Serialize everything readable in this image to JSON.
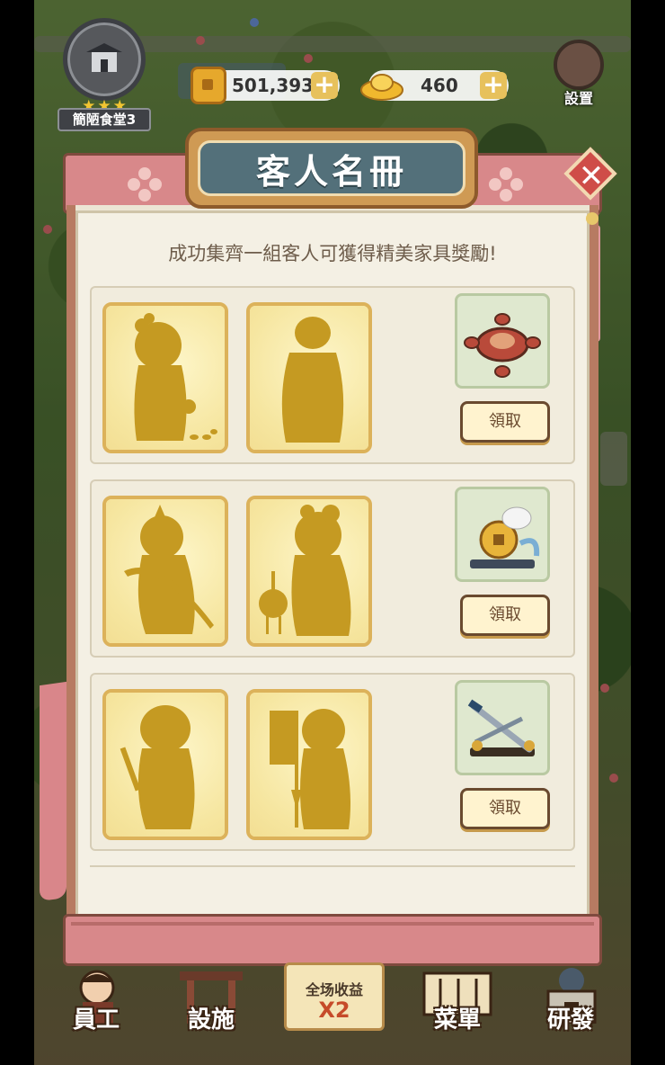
{
  "hud": {
    "restaurant_name": "簡陋食堂3",
    "stars": "★★★",
    "coins": "501,393",
    "gold": "460",
    "settings_label": "設置",
    "plus": "+"
  },
  "dialog": {
    "title": "客人名冊",
    "close": "✕",
    "subtitle": "成功集齊一組客人可獲得精美家具獎勵!",
    "claim_label": "領取",
    "groups": [
      {
        "reward_icon": "round-table-set-icon",
        "guests": [
          "guest-silhouette-lady",
          "guest-silhouette-scholar"
        ]
      },
      {
        "reward_icon": "lucky-coin-rabbit-decor-icon",
        "guests": [
          "guest-silhouette-archer",
          "guest-silhouette-lantern-girl"
        ]
      },
      {
        "reward_icon": "sword-rack-icon",
        "guests": [
          "guest-silhouette-swordsman",
          "guest-silhouette-banner-bearer"
        ]
      }
    ]
  },
  "nav": {
    "staff": "員工",
    "facilities": "設施",
    "boost_line1": "全场收益",
    "boost_line2": "X2",
    "menu": "菜單",
    "research": "研發"
  },
  "colors": {
    "panel": "#f4f0e4",
    "scroll_rod": "#d8888a",
    "card_gold": "#f5e7a4",
    "silhouette": "#c59a22",
    "title_plaque": "#53707a"
  }
}
